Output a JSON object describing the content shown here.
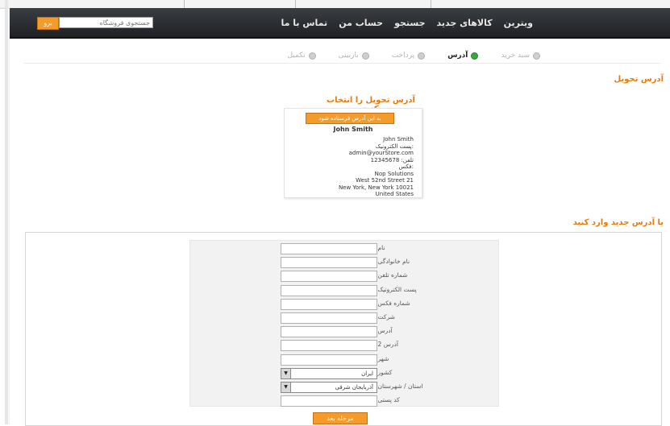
{
  "nav": {
    "items": [
      "ویترین",
      "کالاهای جدید",
      "جستجو",
      "حساب من",
      "تماس با ما"
    ],
    "search_placeholder": "جستجوی فروشگاه",
    "search_button": "برو"
  },
  "steps": [
    {
      "label": "سبد خرید",
      "active": false
    },
    {
      "label": "آدرس",
      "active": true
    },
    {
      "label": "پرداخت",
      "active": false
    },
    {
      "label": "بازبینی",
      "active": false
    },
    {
      "label": "تکمیل",
      "active": false
    }
  ],
  "page_title": "آدرس تحویل",
  "choose_title": "آدرس تحویل را انتخاب کنید",
  "address_card": {
    "ship_button": "به این آدرس فرستاده شود",
    "name": "John Smith",
    "lines": [
      "John   Smith",
      "پست الکترونیک:",
      "admin@yourStore.com",
      "تلفن:   12345678",
      "فکس:",
      "Nop Solutions",
      "West 52nd Street   21",
      "New York,   New York   10021",
      "United States"
    ]
  },
  "new_address_title": "یا آدرس جدید وارد کنید",
  "form": {
    "fields": [
      {
        "label": "نام:",
        "type": "text",
        "value": ""
      },
      {
        "label": "نام خانوادگی:",
        "type": "text",
        "value": ""
      },
      {
        "label": "شماره تلفن:",
        "type": "text",
        "value": ""
      },
      {
        "label": "پست الکترونیک:",
        "type": "text",
        "value": ""
      },
      {
        "label": "شماره فکس:",
        "type": "text",
        "value": ""
      },
      {
        "label": "شرکت:",
        "type": "text",
        "value": ""
      },
      {
        "label": "آدرس:",
        "type": "text",
        "value": ""
      },
      {
        "label": "آدرس 2:",
        "type": "text",
        "value": ""
      },
      {
        "label": "شهر:",
        "type": "text",
        "value": ""
      },
      {
        "label": "کشور:",
        "type": "select",
        "value": "ایران"
      },
      {
        "label": "استان / شهرستان:",
        "type": "select",
        "value": "آذربایجان شرقی"
      },
      {
        "label": "کد پستی:",
        "type": "text",
        "value": ""
      }
    ],
    "next_button": "مرحله بعد"
  }
}
